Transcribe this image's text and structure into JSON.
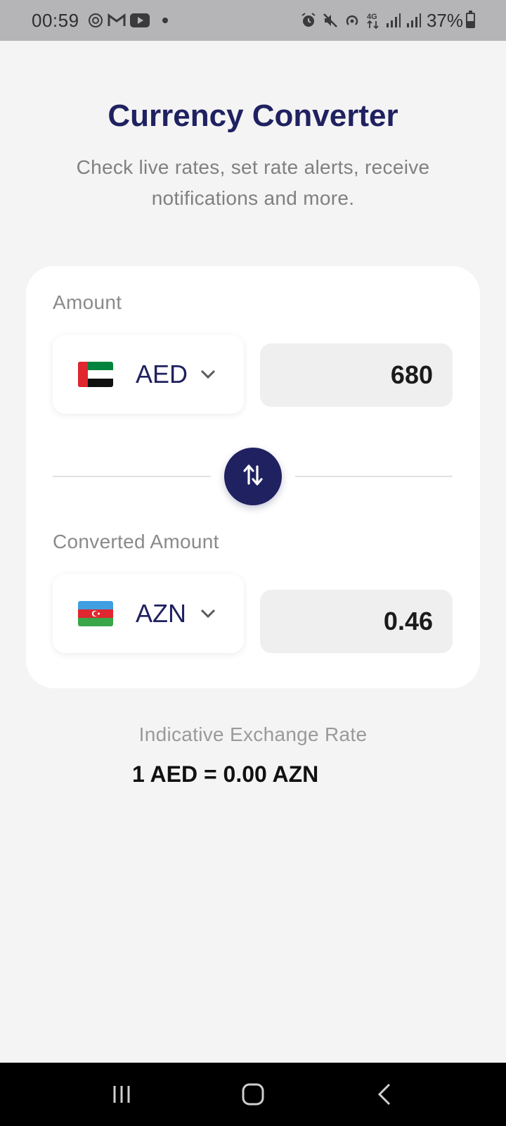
{
  "status_bar": {
    "time": "00:59",
    "battery": "37%",
    "left_icons": [
      "chrome-icon",
      "gmail-icon",
      "youtube-icon",
      "notification-dot"
    ],
    "right_icons": [
      "alarm-icon",
      "mute-icon",
      "hotspot-icon",
      "4g-icon",
      "signal-icon",
      "signal-icon"
    ]
  },
  "header": {
    "title": "Currency Converter",
    "subtitle": "Check live rates, set rate alerts, receive notifications and more."
  },
  "converter": {
    "amount_label": "Amount",
    "from_currency": "AED",
    "from_flag": "uae-flag-icon",
    "amount_value": "680",
    "converted_label": "Converted Amount",
    "to_currency": "AZN",
    "to_flag": "azerbaijan-flag-icon",
    "converted_value": "0.46"
  },
  "rate": {
    "label": "Indicative Exchange Rate",
    "value": "1 AED = 0.00 AZN"
  },
  "colors": {
    "primary": "#1f2160",
    "background": "#f4f4f5",
    "card": "#ffffff",
    "input_bg": "#efefef"
  }
}
